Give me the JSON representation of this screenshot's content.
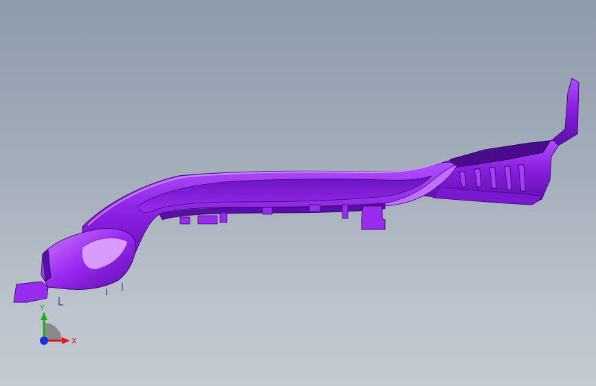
{
  "viewport": {
    "background_top": "#8e9bac",
    "background_bottom": "#c4cad2"
  },
  "model": {
    "part_color": "#8a1ee0",
    "edge_color": "#3d0878",
    "highlight_color": "#c070ff",
    "shadow_color": "#4a0c8c"
  },
  "triad": {
    "x_label": "X",
    "y_label": "Y",
    "x_color": "#e01818",
    "y_color": "#18b018",
    "z_color": "#1830e0",
    "x_icon": "x-axis-arrow-icon",
    "y_icon": "y-axis-arrow-icon",
    "z_icon": "z-axis-origin-icon"
  }
}
